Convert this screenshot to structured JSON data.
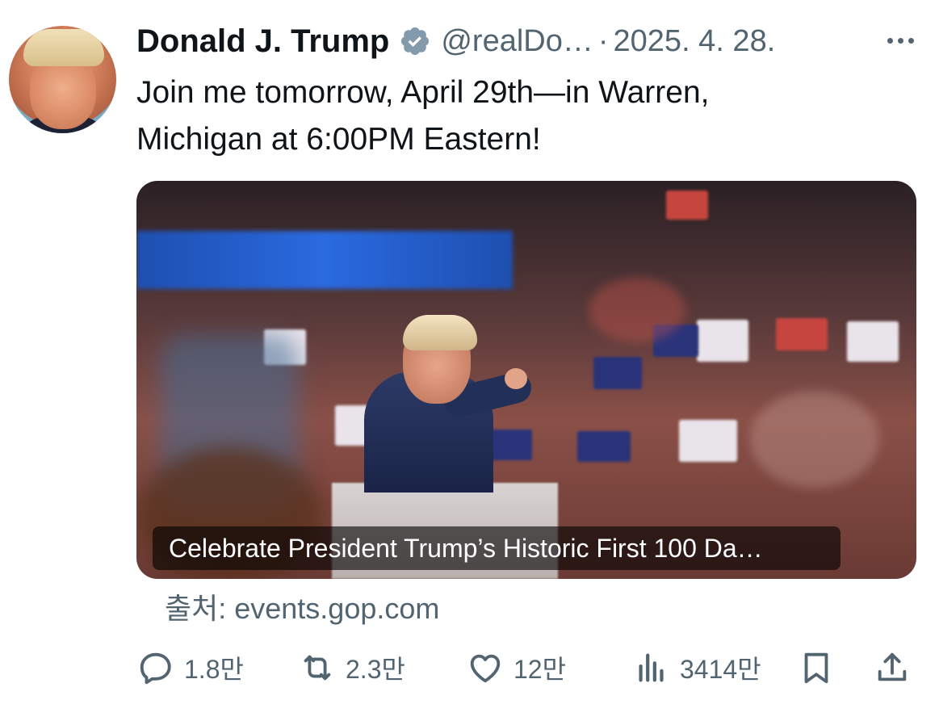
{
  "author": {
    "name": "Donald J. Trump",
    "handle": "@realDo…",
    "separator": "·",
    "date": "2025. 4. 28.",
    "verified": true,
    "avatar_icon": "profile-photo"
  },
  "tweet": {
    "text_line1": "Join me tomorrow, April 29th—in Warren,",
    "text_line2": "Michigan at 6:00PM Eastern!"
  },
  "card": {
    "headline": "Celebrate President Trump’s Historic First 100 Da…",
    "source": "출처: events.gop.com"
  },
  "actions": {
    "reply_count": "1.8만",
    "retweet_count": "2.3만",
    "like_count": "12만",
    "view_count": "3414만"
  },
  "colors": {
    "text": "#0f1419",
    "secondary": "#536471",
    "verified_badge": "#829aab"
  }
}
